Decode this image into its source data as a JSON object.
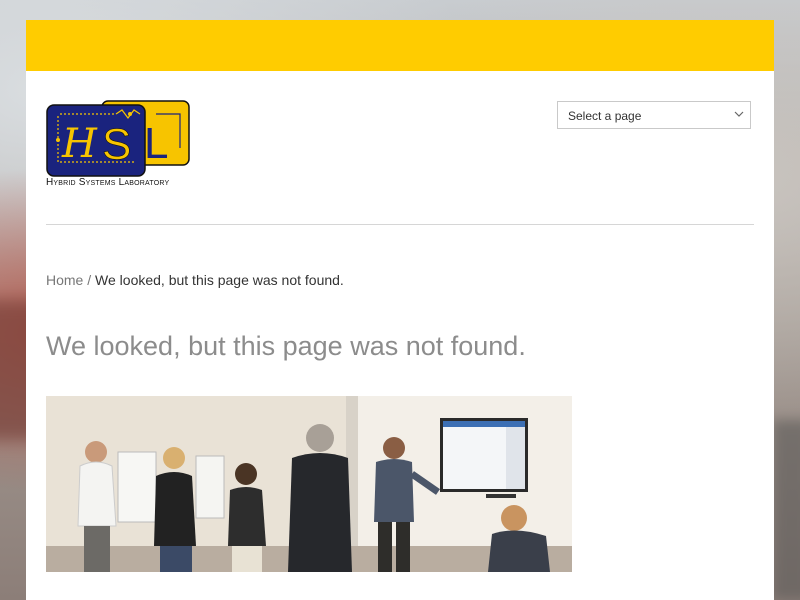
{
  "site": {
    "logo_letters": "HSL",
    "logo_caption": "Hybrid Systems Laboratory"
  },
  "nav": {
    "select_placeholder": "Select a page"
  },
  "breadcrumb": {
    "home_label": "Home",
    "separator": "/",
    "current": "We looked, but this page was not found."
  },
  "main": {
    "title": "We looked, but this page was not found."
  },
  "colors": {
    "accent_bar": "#ffcc00",
    "logo_navy": "#1a237e",
    "logo_yellow": "#f7c400",
    "title_gray": "#8c8c8c"
  },
  "icons": {
    "select_chevron": "chevron-down-icon"
  }
}
